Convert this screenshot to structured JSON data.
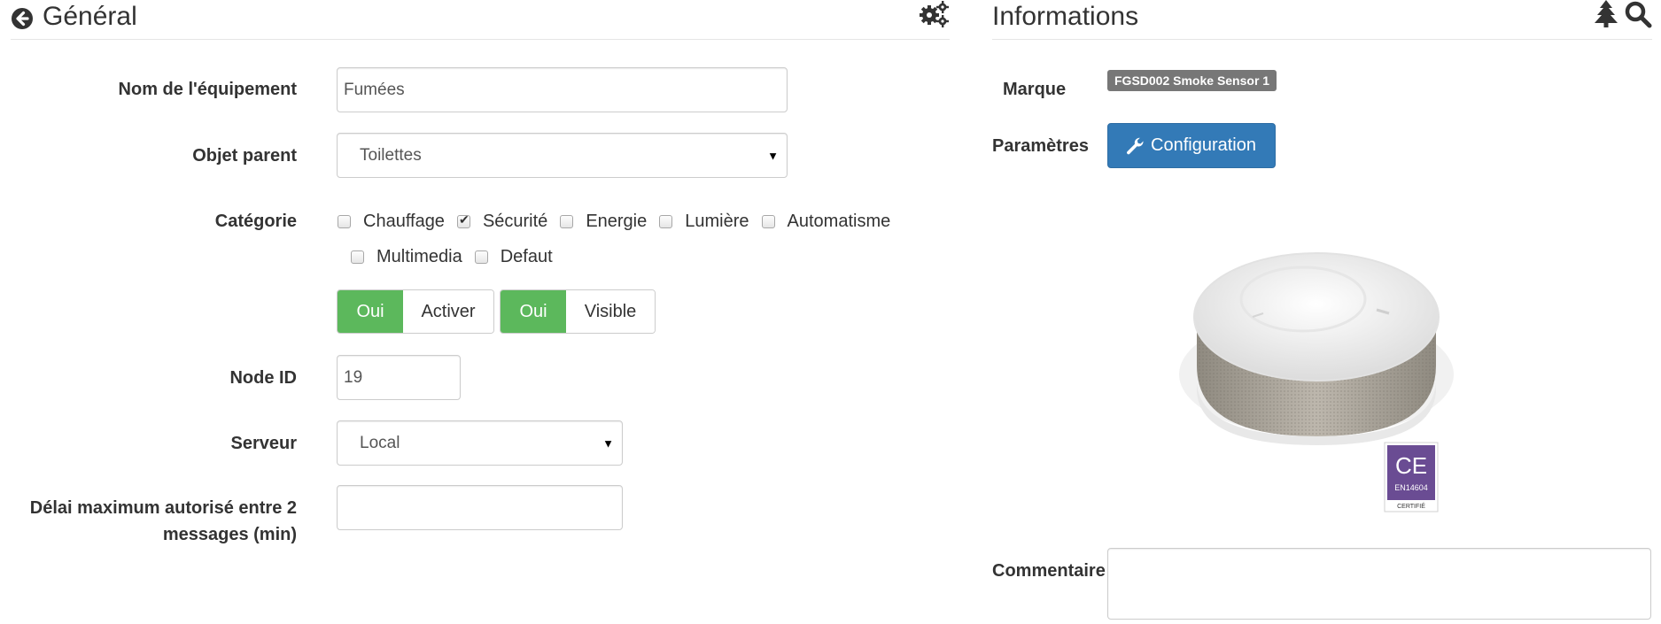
{
  "general": {
    "title": "Général",
    "back_icon": "arrow-circle-left-icon",
    "settings_icon": "gears-icon",
    "fields": {
      "name_label": "Nom de l'équipement",
      "name_value": "Fumées",
      "parent_label": "Objet parent",
      "parent_value": "Toilettes",
      "category_label": "Catégorie",
      "categories": [
        {
          "label": "Chauffage",
          "checked": false
        },
        {
          "label": "Sécurité",
          "checked": true
        },
        {
          "label": "Energie",
          "checked": false
        },
        {
          "label": "Lumière",
          "checked": false
        },
        {
          "label": "Automatisme",
          "checked": false
        },
        {
          "label": "Multimedia",
          "checked": false
        },
        {
          "label": "Defaut",
          "checked": false
        }
      ],
      "activate_on": "Oui",
      "activate_label": "Activer",
      "visible_on": "Oui",
      "visible_label": "Visible",
      "node_id_label": "Node ID",
      "node_id_value": "19",
      "server_label": "Serveur",
      "server_value": "Local",
      "delay_label": "Délai maximum autorisé entre 2 messages (min)",
      "delay_value": ""
    }
  },
  "informations": {
    "title": "Informations",
    "tree_icon": "tree-icon",
    "search_icon": "search-icon",
    "brand_label": "Marque",
    "brand_badge": "FGSD002 Smoke Sensor 1",
    "params_label": "Paramètres",
    "config_button": "Configuration",
    "wrench_icon": "wrench-icon",
    "product_image": {
      "alt": "smoke-sensor-image",
      "ce_mark": "CE",
      "ce_norm": "EN14604",
      "ce_cert": "CERTIFIÉ"
    },
    "comment_label": "Commentaire",
    "comment_value": ""
  },
  "colors": {
    "success": "#5cb85c",
    "primary": "#337ab7",
    "badge": "#777777",
    "ce_purple": "#6a4c93"
  }
}
